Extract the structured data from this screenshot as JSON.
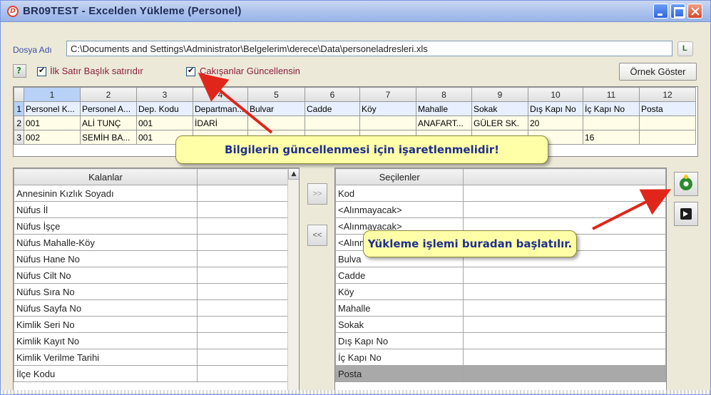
{
  "window": {
    "title": "BR09TEST - Excelden Yükleme (Personel)"
  },
  "file": {
    "label": "Dosya Adı",
    "path": "C:\\Documents and Settings\\Administrator\\Belgelerim\\derece\\Data\\personeladresleri.xls",
    "browse_icon": "folder-open-icon"
  },
  "options": {
    "help_label": "?",
    "first_row_header": {
      "label": "İlk Satır Başlık satırıdır",
      "checked": true
    },
    "update_conflicts": {
      "label": "Çakışanlar Güncellensin",
      "checked": true
    },
    "preview_button": "Örnek Göster"
  },
  "grid": {
    "columns": [
      "1",
      "2",
      "3",
      "4",
      "5",
      "6",
      "7",
      "8",
      "9",
      "10",
      "11",
      "12"
    ],
    "rows": [
      {
        "num": "1",
        "cells": [
          "Personel K...",
          "Personel A...",
          "Dep. Kodu",
          "Departman...",
          "Bulvar",
          "Cadde",
          "Köy",
          "Mahalle",
          "Sokak",
          "Dış Kapı No",
          "İç Kapı No",
          "Posta"
        ]
      },
      {
        "num": "2",
        "cells": [
          "001",
          "ALİ TUNÇ",
          "001",
          "İDARİ",
          "",
          "",
          "",
          "ANAFART...",
          "GÜLER SK.",
          "20",
          "",
          ""
        ]
      },
      {
        "num": "3",
        "cells": [
          "002",
          "SEMİH BA...",
          "001",
          "",
          "",
          "",
          "",
          "",
          "",
          "",
          "16",
          ""
        ]
      }
    ]
  },
  "remaining": {
    "header": "Kalanlar",
    "items": [
      "Annesinin Kızlık Soyadı",
      "Nüfus İl",
      "Nüfus İşçe",
      "Nüfus Mahalle-Köy",
      "Nüfus Hane No",
      "Nüfus Cilt No",
      "Nüfus Sıra No",
      "Nüfus Sayfa No",
      "Kimlik Seri No",
      "Kimlik Kayıt No",
      "Kimlik Verilme Tarihi",
      "İlçe Kodu"
    ]
  },
  "selected": {
    "header": "Seçilenler",
    "items": [
      "Kod",
      "<Alınmayacak>",
      "<Alınmayacak>",
      "<Alınm",
      "Bulva",
      "Cadde",
      "Köy",
      "Mahalle",
      "Sokak",
      "Dış Kapı No",
      "İç Kapı No",
      "Posta"
    ],
    "highlighted_index": 11
  },
  "buttons": {
    "add": ">>",
    "remove": "<<",
    "run_icon": "gear-icon",
    "exit_icon": "exit-icon"
  },
  "callouts": {
    "update_hint": "Bilgilerin güncellenmesi için işaretlenmelidir!",
    "run_hint": "Yükleme işlemi buradan başlatılır."
  },
  "colors": {
    "title_bar": "#a9c0ec",
    "callout_bg": "#ffffa8",
    "callout_text": "#1f2f8c",
    "arrow": "#e0261b",
    "label_red": "#8b1d3e",
    "label_blue": "#3a4ea8"
  }
}
